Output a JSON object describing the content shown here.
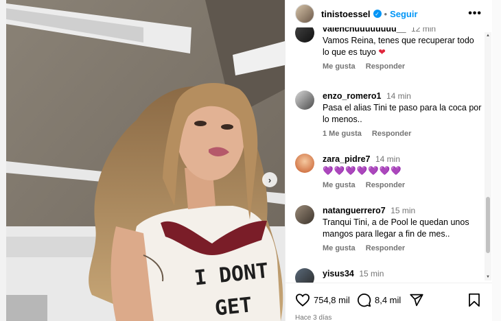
{
  "post": {
    "username": "tinistoessel",
    "separator": "•",
    "follow_label": "Seguir",
    "more_label": "•••",
    "shirt_text_1": "I DONT",
    "shirt_text_2": "GET"
  },
  "comments": [
    {
      "username": "valenchuuuuuuuu__",
      "time": "12 min",
      "text": "Vamos Reina, tenes que recuperar todo lo que es tuyo",
      "emoji": "❤",
      "likes_label": "Me gusta",
      "reply_label": "Responder"
    },
    {
      "username": "enzo_romero1",
      "time": "14 min",
      "text": "Pasa el alias Tini te paso para la coca por lo menos..",
      "likes_label": "1 Me gusta",
      "reply_label": "Responder"
    },
    {
      "username": "zara_pidre7",
      "time": "14 min",
      "text": "💜💜💜💜💜💜💜",
      "likes_label": "Me gusta",
      "reply_label": "Responder"
    },
    {
      "username": "natanguerrero7",
      "time": "15 min",
      "text": "Tranqui Tini, a de Pool le quedan unos mangos para llegar a fin de mes..",
      "likes_label": "Me gusta",
      "reply_label": "Responder"
    },
    {
      "username": "yisus34",
      "time": "15 min",
      "text": "❤❤"
    }
  ],
  "actions": {
    "likes_count": "754,8 mil",
    "comments_count": "8,4 mil",
    "posted": "Hace 3 días"
  },
  "icons": {
    "next": "chevron-right-icon",
    "verified": "verified-badge-icon",
    "like": "heart-icon",
    "comment": "comment-icon",
    "share": "send-icon",
    "save": "bookmark-icon"
  },
  "colors": {
    "accent": "#0095f6",
    "heart": "#e0263c",
    "muted": "#737373"
  }
}
